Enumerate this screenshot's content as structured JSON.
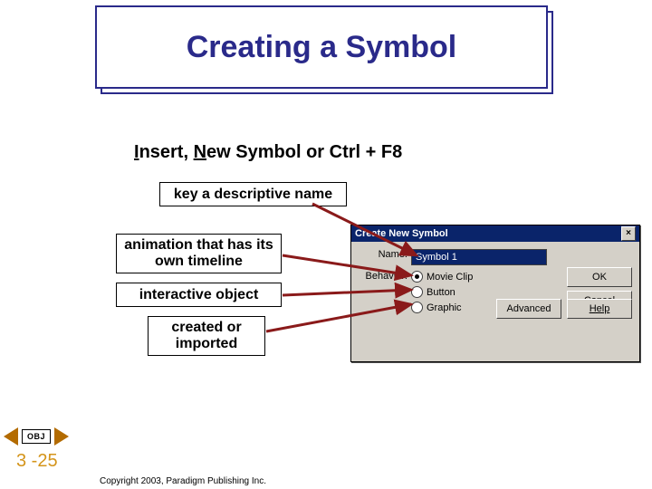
{
  "title": "Creating a Symbol",
  "instr_prefix": "I",
  "instr_mid1": "nsert, ",
  "instr_ul2": "N",
  "instr_mid2": "ew Symbol or Ctrl + F",
  "instr_end": "8",
  "notes": {
    "name": "key a descriptive name",
    "movie": "animation that has its own timeline",
    "button": "interactive object",
    "graphic": "created or imported"
  },
  "dialog": {
    "title": "Create New Symbol",
    "name_label": "Name:",
    "name_value": "Symbol 1",
    "behavior_label": "Behavior:",
    "opt_movie": "Movie Clip",
    "opt_button": "Button",
    "opt_graphic": "Graphic",
    "btn_ok": "OK",
    "btn_cancel": "Cancel",
    "btn_adv": "Advanced",
    "btn_help": "Help"
  },
  "nav": {
    "obj": "OBJ",
    "page": "3 -25"
  },
  "copyright": "Copyright 2003, Paradigm Publishing Inc."
}
